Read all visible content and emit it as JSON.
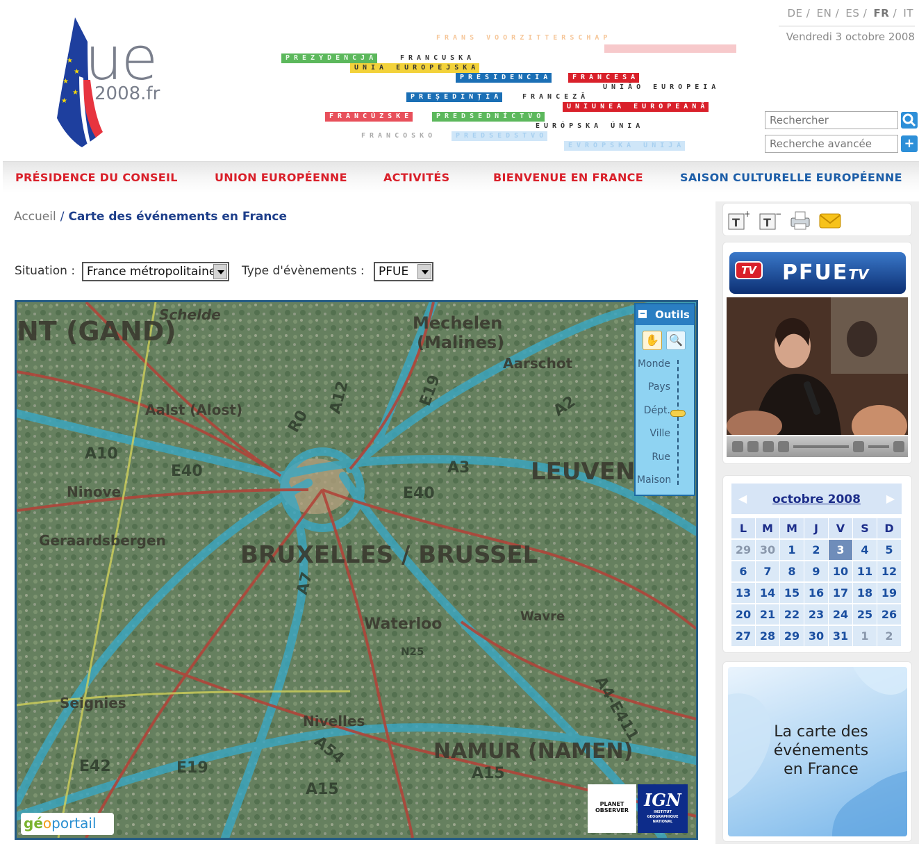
{
  "header": {
    "logo": {
      "ue": "ue",
      "domain": "2008.fr"
    },
    "languages": [
      {
        "code": "DE",
        "current": false
      },
      {
        "code": "EN",
        "current": false
      },
      {
        "code": "ES",
        "current": false
      },
      {
        "code": "FR",
        "current": true
      },
      {
        "code": "IT",
        "current": false
      }
    ],
    "date": "Vendredi 3 octobre 2008",
    "search_placeholder": "Rechercher",
    "advanced_search": "Recherche avancée",
    "banner": [
      {
        "text": "FRANS VOORZITTERSCHAP",
        "color": "#f6c79a"
      },
      {
        "text": "PREZYDENCJA",
        "color": "#5cb85c"
      },
      {
        "text": "FRANCUSKA",
        "color": "#333333"
      },
      {
        "text": "UNIA EUROPEJSKA",
        "color": "#f3d23a"
      },
      {
        "text": "PRESIDENCIA",
        "color": "#1b6fb5"
      },
      {
        "text": "FRANCESA",
        "color": "#d9202a"
      },
      {
        "text": "UNIÃO EUROPEIA",
        "color": "#333333"
      },
      {
        "text": "PREȘEDINȚIA",
        "color": "#1b6fb5"
      },
      {
        "text": "FRANCEZĂ",
        "color": "#333333"
      },
      {
        "text": "UNIUNEA EUROPEANĂ",
        "color": "#d9202a"
      },
      {
        "text": "FRANCÚZSKE",
        "color": "#e8505b"
      },
      {
        "text": "PREDSEDNÍCTVO",
        "color": "#5cb85c"
      },
      {
        "text": "EURÓPSKA ÚNIA",
        "color": "#333333"
      },
      {
        "text": "FRANCOSKO",
        "color": "#aaaaaa"
      },
      {
        "text": "PREDSEDSTVO",
        "color": "#a8d0f0"
      },
      {
        "text": "EVROPSKA UNIJA",
        "color": "#a8d0f0"
      }
    ]
  },
  "nav": [
    {
      "label": "PRÉSIDENCE DU CONSEIL",
      "color": "#d9202a"
    },
    {
      "label": "UNION EUROPÉENNE",
      "color": "#d9202a"
    },
    {
      "label": "ACTIVITÉS",
      "color": "#d9202a"
    },
    {
      "label": "BIENVENUE EN FRANCE",
      "color": "#d9202a"
    },
    {
      "label": "SAISON CULTURELLE EUROPÉENNE",
      "color": "#1d5ea8"
    }
  ],
  "breadcrumb": {
    "home": "Accueil",
    "separator": "/",
    "current": "Carte des événements en France"
  },
  "filters": {
    "situation_label": "Situation :",
    "situation_value": "France métropolitaine",
    "type_label": "Type d'évènements :",
    "type_value": "PFUE"
  },
  "map": {
    "tools_title": "Outils",
    "zoom_levels": [
      "Monde",
      "Pays",
      "Dépt.",
      "Ville",
      "Rue",
      "Maison"
    ],
    "zoom_current": "Dépt.",
    "place_labels": [
      "NT (GAND)",
      "Mechelen",
      "(Malines)",
      "Aarschot",
      "Aalst (Alost)",
      "Ninove",
      "Geraardsbergen",
      "BRUXELLES / BRUSSEL",
      "Waterloo",
      "Wavre",
      "LEUVEN",
      "Seignies",
      "Nivelles",
      "NAMUR (NAMEN)",
      "Schelde"
    ],
    "road_labels": [
      "A10",
      "E40",
      "A12",
      "E19",
      "A2",
      "A3",
      "E40",
      "A7",
      "A4-E411",
      "A54",
      "A15",
      "E42",
      "A15",
      "E19",
      "N25",
      "R0"
    ],
    "logos": {
      "geoportail": {
        "ge": "gé",
        "o": "o",
        "portail": "portail"
      },
      "planet_observer": "PLANET OBSERVER",
      "ign": {
        "mark": "IGN",
        "sub": "INSTITUT GEOGRAPHIQUE NATIONAL"
      }
    }
  },
  "sidebar": {
    "tools": [
      "text-larger-icon",
      "text-smaller-icon",
      "print-icon",
      "email-icon"
    ],
    "tv": {
      "badge": "TV",
      "title": "PFUE",
      "suffix": "TV"
    },
    "calendar": {
      "month": "octobre 2008",
      "weekdays": [
        "L",
        "M",
        "M",
        "J",
        "V",
        "S",
        "D"
      ],
      "weeks": [
        [
          "29",
          "30",
          "1",
          "2",
          "3",
          "4",
          "5"
        ],
        [
          "6",
          "7",
          "8",
          "9",
          "10",
          "11",
          "12"
        ],
        [
          "13",
          "14",
          "15",
          "16",
          "17",
          "18",
          "19"
        ],
        [
          "20",
          "21",
          "22",
          "23",
          "24",
          "25",
          "26"
        ],
        [
          "27",
          "28",
          "29",
          "30",
          "31",
          "1",
          "2"
        ]
      ],
      "today": "3"
    },
    "mapcard": [
      "La carte des",
      "événements",
      "en France"
    ]
  }
}
